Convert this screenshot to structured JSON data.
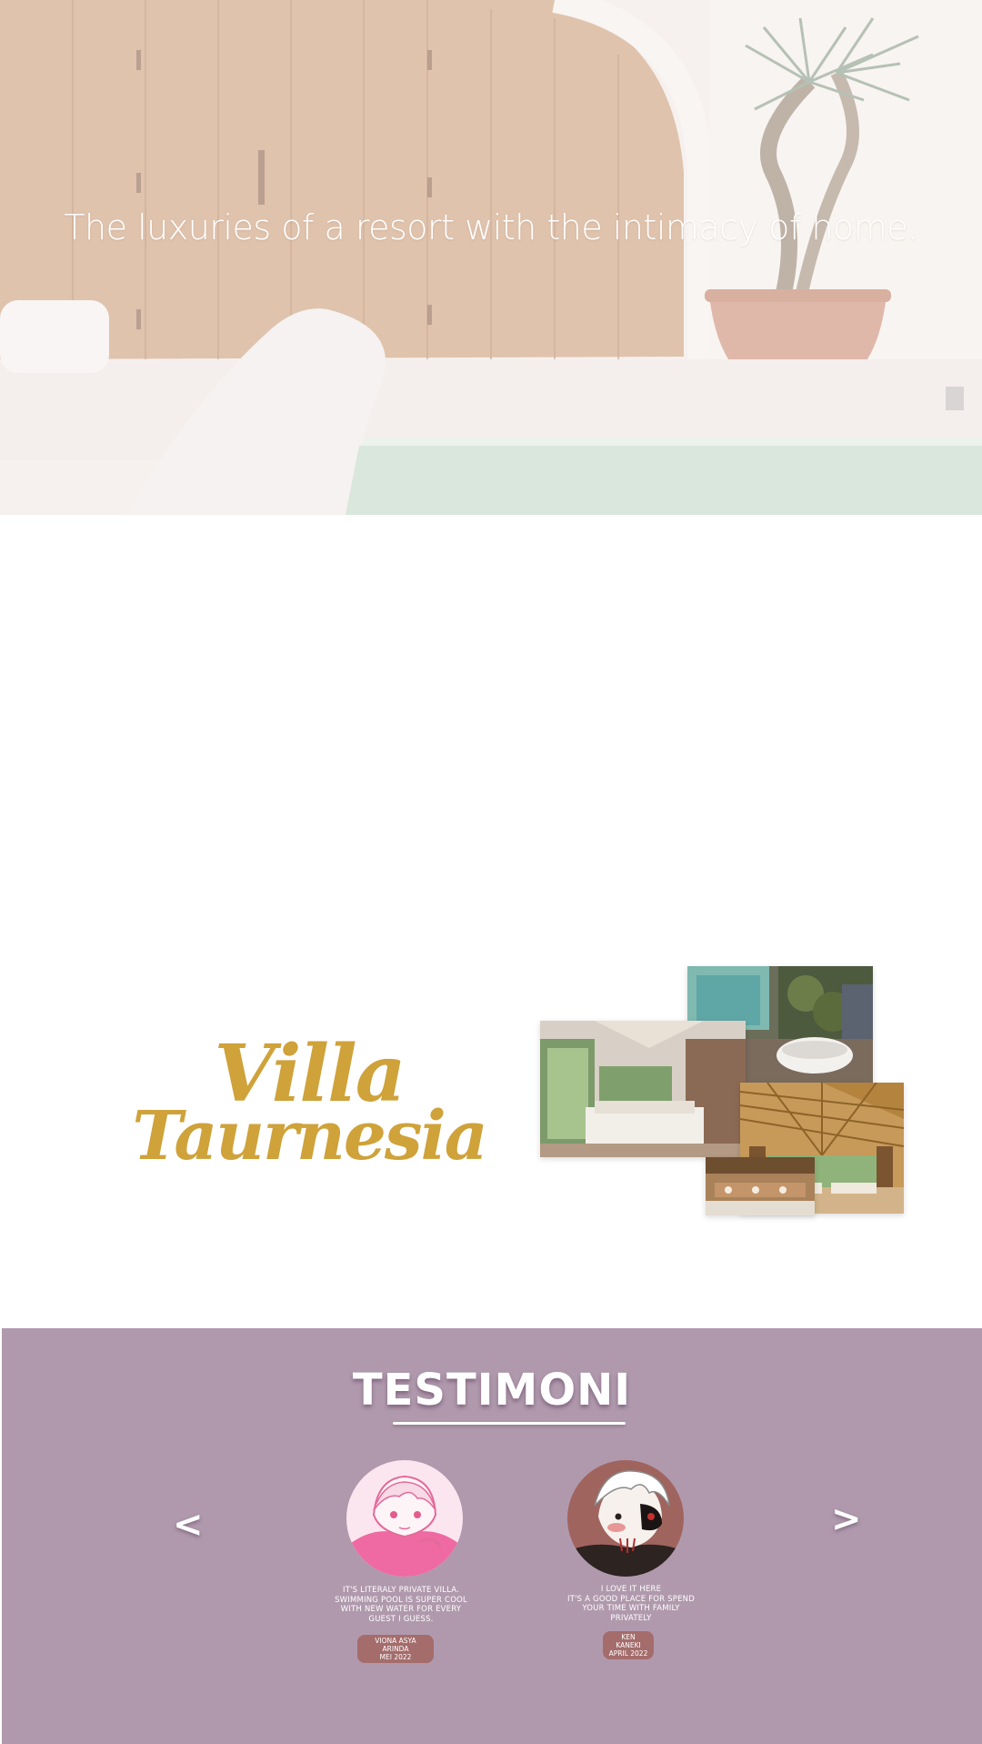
{
  "hero": {
    "tagline": "The luxuries of a resort with the intimacy of home."
  },
  "villa": {
    "brand_line1": "Villa",
    "brand_line2": "Taurnesia"
  },
  "testimonials": {
    "title": "TESTIMONI",
    "prev_label": "<",
    "next_label": ">",
    "items": [
      {
        "quote": "IT'S LITERALY PRIVATE VILLA.\nSWIMMING POOL IS SUPER COOL\nWITH NEW WATER FOR EVERY\nGUEST I GUESS.",
        "author": "VIONA ASYA ARINDA\nMEI 2022"
      },
      {
        "quote": "I LOVE IT HERE\nIT'S A GOOD PLACE FOR SPEND\nYOUR TIME WITH FAMILY\nPRIVATELY",
        "author": "KEN KANEKI\nAPRIL 2022"
      }
    ]
  },
  "colors": {
    "brand_gold": "#cfa23a",
    "testimonial_bg": "#b099ad",
    "name_pill": "#a56c6c"
  },
  "icons": {
    "prev": "chevron-left-icon",
    "next": "chevron-right-icon"
  }
}
